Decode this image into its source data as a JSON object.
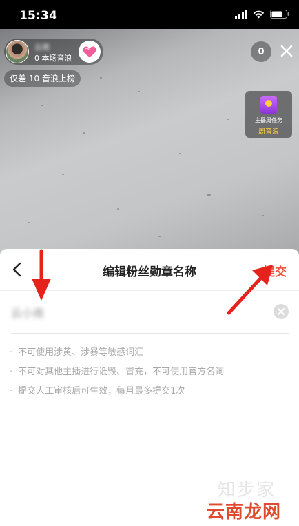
{
  "status_bar": {
    "time": "15:34"
  },
  "live_room": {
    "host_name": "云南",
    "host_sub": "0 本场音浪",
    "viewer_count": "0",
    "rank_tip": "仅差 10 音浪上榜",
    "task": {
      "label": "主播周任务",
      "sub": "周音浪"
    }
  },
  "sheet": {
    "title": "编辑粉丝勋章名称",
    "submit_label": "提交",
    "input_value": "云小南",
    "rules": [
      "不可使用涉黄、涉暴等敏感词汇",
      "不可对其他主播进行诋毁、冒充，不可使用官方名词",
      "提交人工审核后可生效，每月最多提交1次"
    ]
  },
  "watermark": {
    "line1": "知步家",
    "line2": "云南龙网"
  },
  "colors": {
    "accent": "#f0533e",
    "arrow": "#e5231c",
    "task_label": "#ffcf3d"
  },
  "icons": {
    "back": "chevron-left-icon",
    "close": "close-icon",
    "clear": "clear-icon",
    "heart": "heart-icon",
    "task": "task-icon",
    "wifi": "wifi-icon",
    "signal": "signal-icon",
    "battery": "battery-icon"
  }
}
